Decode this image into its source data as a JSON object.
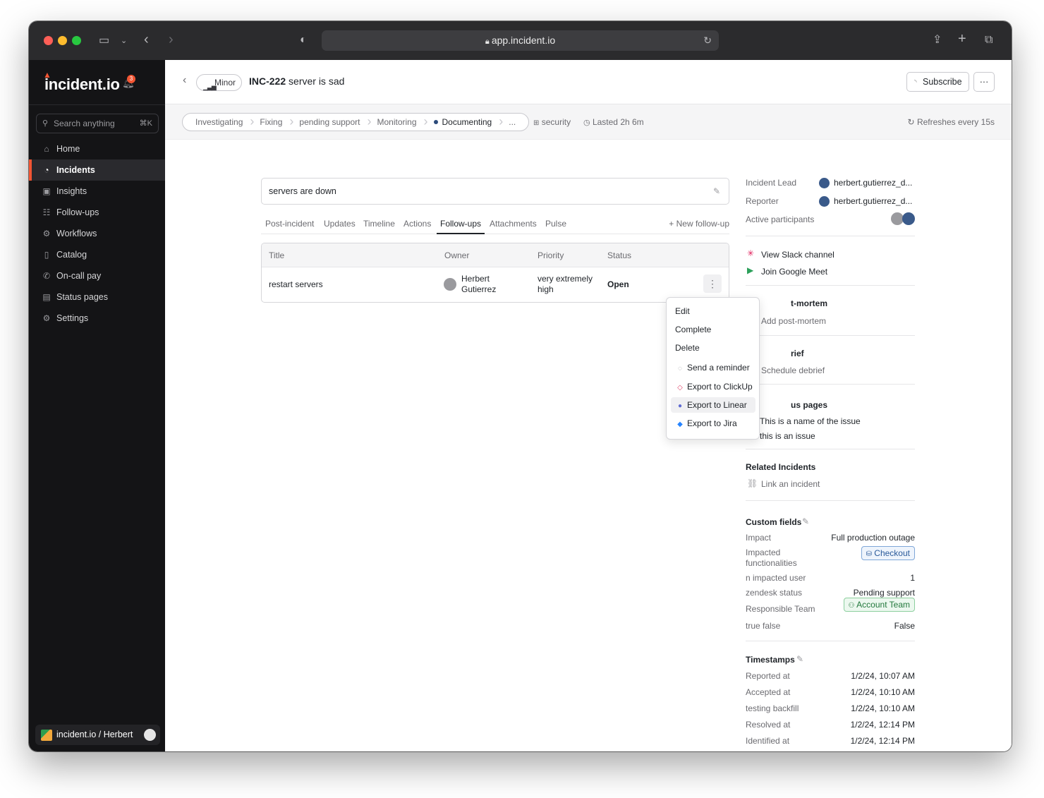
{
  "browser": {
    "url": "app.incident.io"
  },
  "sidebar": {
    "logo": "incident.io",
    "notification_count": "3",
    "search_placeholder": "Search anything",
    "search_shortcut": "⌘K",
    "items": [
      {
        "label": "Home",
        "icon": "home-icon"
      },
      {
        "label": "Incidents",
        "icon": "flame-icon",
        "active": true
      },
      {
        "label": "Insights",
        "icon": "chart-icon"
      },
      {
        "label": "Follow-ups",
        "icon": "list-icon"
      },
      {
        "label": "Workflows",
        "icon": "workflow-icon"
      },
      {
        "label": "Catalog",
        "icon": "book-icon"
      },
      {
        "label": "On-call pay",
        "icon": "phone-icon"
      },
      {
        "label": "Status pages",
        "icon": "status-page-icon"
      },
      {
        "label": "Settings",
        "icon": "gear-icon"
      }
    ],
    "org": "incident.io / Herbert"
  },
  "header": {
    "severity": "Minor",
    "incident_id": "INC-222",
    "incident_name": "server is sad",
    "subscribe": "Subscribe",
    "more": "···"
  },
  "statusbar": {
    "steps": [
      "Investigating",
      "Fixing",
      "pending support",
      "Monitoring",
      "Documenting",
      "..."
    ],
    "current_step": "Documenting",
    "type": "security",
    "duration": "Lasted 2h 6m",
    "refresh": "Refreshes every 15s"
  },
  "summary": "servers are down",
  "tabs": [
    "Post-incident",
    "Updates",
    "Timeline",
    "Actions",
    "Follow-ups",
    "Attachments",
    "Pulse"
  ],
  "active_tab": "Follow-ups",
  "new_followup": "+ New follow-up",
  "followups": {
    "columns": [
      "Title",
      "Owner",
      "Priority",
      "Status"
    ],
    "rows": [
      {
        "title": "restart servers",
        "owner_line1": "Herbert",
        "owner_line2": "Gutierrez",
        "priority_line1": "very extremely",
        "priority_line2": "high",
        "status": "Open"
      }
    ]
  },
  "menu": {
    "items": [
      "Edit",
      "Complete",
      "Delete",
      "Send a reminder",
      "Export to ClickUp",
      "Export to Linear",
      "Export to Jira"
    ],
    "highlighted": "Export to Linear"
  },
  "details": {
    "incident_lead_label": "Incident Lead",
    "incident_lead": "herbert.gutierrez_d...",
    "reporter_label": "Reporter",
    "reporter": "herbert.gutierrez_d...",
    "participants_label": "Active participants",
    "slack": "View Slack channel",
    "meet": "Join Google Meet",
    "postmortem_head": "t-mortem",
    "postmortem_link": "Add post-mortem",
    "debrief_head": "rief",
    "debrief_link": "Schedule debrief",
    "status_pages_head": "us pages",
    "status_page_1": "This is a name of the issue",
    "status_page_2": "this is an issue",
    "related_head": "Related Incidents",
    "related_link": "Link an incident",
    "custom_head": "Custom fields",
    "custom_fields": [
      {
        "label": "Impact",
        "value": "Full production outage"
      },
      {
        "label": "Impacted functionalities",
        "value": "Checkout"
      },
      {
        "label": "n impacted user",
        "value": "1"
      },
      {
        "label": "zendesk status",
        "value": "Pending support"
      },
      {
        "label": "Responsible Team",
        "value": "Account Team"
      },
      {
        "label": "true false",
        "value": "False"
      }
    ],
    "timestamps_head": "Timestamps",
    "timestamps": [
      {
        "label": "Reported at",
        "value": "1/2/24, 10:07 AM"
      },
      {
        "label": "Accepted at",
        "value": "1/2/24, 10:10 AM"
      },
      {
        "label": "testing backfill",
        "value": "1/2/24, 10:10 AM"
      },
      {
        "label": "Resolved at",
        "value": "1/2/24, 12:14 PM"
      },
      {
        "label": "Identified at",
        "value": "1/2/24, 12:14 PM"
      }
    ]
  }
}
